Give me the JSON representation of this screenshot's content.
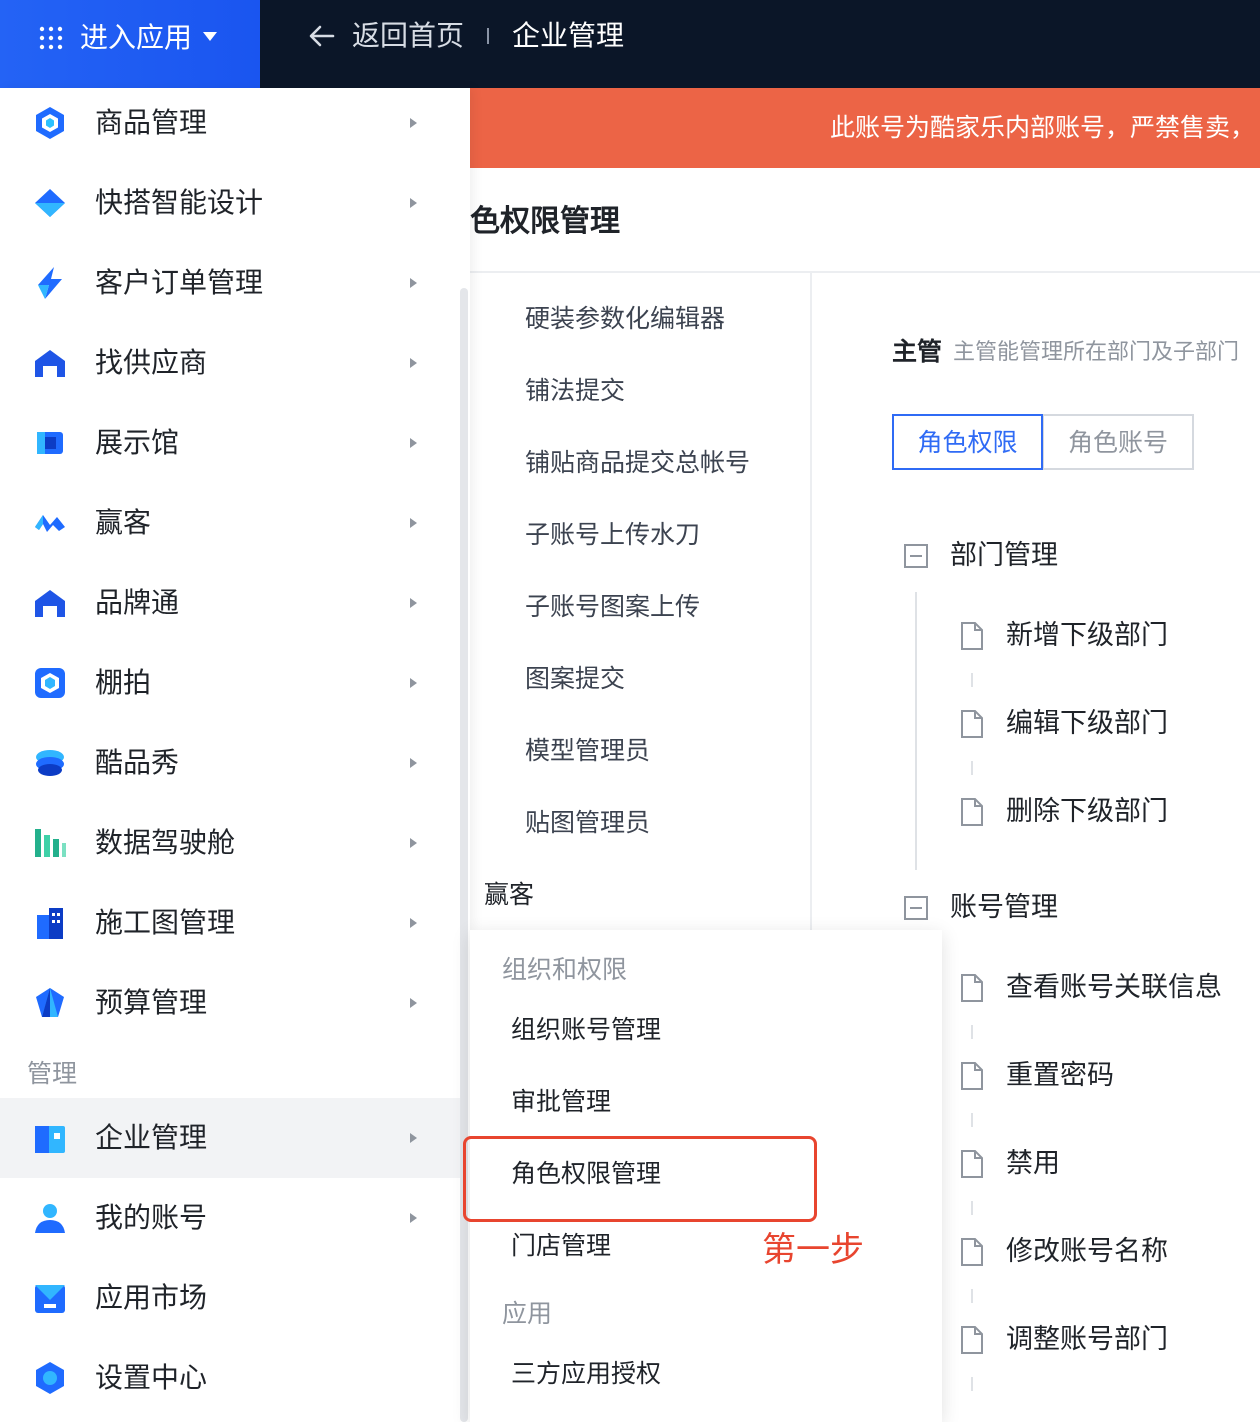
{
  "topbar": {
    "enter_app": "进入应用",
    "back_home": "返回首页",
    "current": "企业管理"
  },
  "sidebar": {
    "items": [
      {
        "label": "商品管理",
        "icon": "hexagon-icon"
      },
      {
        "label": "快搭智能设计",
        "icon": "diamond-icon"
      },
      {
        "label": "客户订单管理",
        "icon": "bolt-icon"
      },
      {
        "label": "找供应商",
        "icon": "house-icon"
      },
      {
        "label": "展示馆",
        "icon": "cube-icon"
      },
      {
        "label": "赢客",
        "icon": "wave-icon"
      },
      {
        "label": "品牌通",
        "icon": "house-icon"
      },
      {
        "label": "棚拍",
        "icon": "aperture-icon"
      },
      {
        "label": "酷品秀",
        "icon": "layers-icon"
      },
      {
        "label": "数据驾驶舱",
        "icon": "bar-chart-icon"
      },
      {
        "label": "施工图管理",
        "icon": "building-icon"
      },
      {
        "label": "预算管理",
        "icon": "gem-icon"
      }
    ],
    "group_title": "管理",
    "manage_items": [
      {
        "label": "企业管理",
        "icon": "enterprise-icon"
      },
      {
        "label": "我的账号",
        "icon": "user-icon"
      },
      {
        "label": "应用市场",
        "icon": "store-icon"
      },
      {
        "label": "设置中心",
        "icon": "settings-icon"
      }
    ]
  },
  "banner": {
    "text": "此账号为酷家乐内部账号，严禁售卖，"
  },
  "main": {
    "title": "色权限管理",
    "roles": [
      "硬装参数化编辑器",
      "铺法提交",
      "铺贴商品提交总帐号",
      "子账号上传水刀",
      "子账号图案上传",
      "图案提交",
      "模型管理员",
      "贴图管理员"
    ],
    "group_yingke": "赢客",
    "role_name": "主管",
    "role_desc": "主管能管理所在部门及子部门",
    "tabs": [
      "角色权限",
      "角色账号"
    ],
    "tree": [
      {
        "node": "部门管理",
        "leaves": [
          "新增下级部门",
          "编辑下级部门",
          "删除下级部门"
        ]
      },
      {
        "node": "账号管理",
        "leaves": [
          "查看账号关联信息",
          "重置密码",
          "禁用",
          "修改账号名称",
          "调整账号部门"
        ]
      }
    ]
  },
  "flyout": {
    "group1": "组织和权限",
    "items1": [
      "组织账号管理",
      "审批管理",
      "角色权限管理",
      "门店管理"
    ],
    "group2": "应用",
    "items2": [
      "三方应用授权"
    ]
  },
  "annotation": {
    "step": "第一步"
  },
  "colors": {
    "accent": "#2f6bf5",
    "banner": "#ec6446",
    "highlight": "#e8452f",
    "topbar": "#0b1628"
  }
}
